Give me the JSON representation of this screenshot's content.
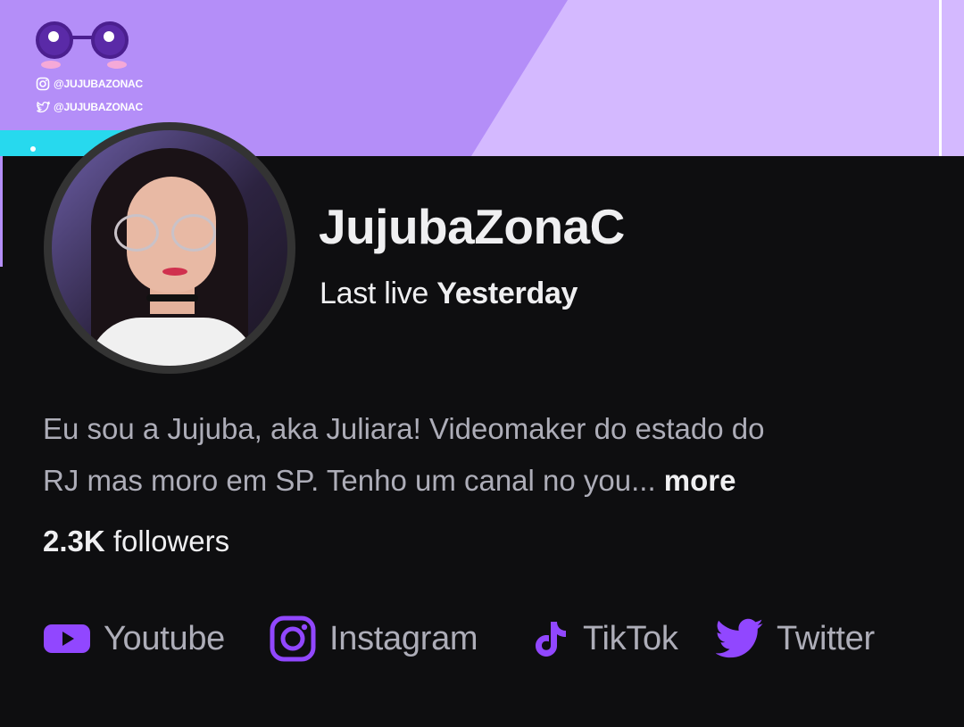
{
  "banner": {
    "instagram_handle": "@JUJUBAZONAC",
    "twitter_handle": "@JUJUBAZONAC",
    "colors": {
      "purple": "#b48ef8",
      "lavender": "#d4b9ff",
      "cyan": "#27d9ee"
    }
  },
  "profile": {
    "name": "JujubaZonaC",
    "last_live_prefix": "Last live",
    "last_live_value": "Yesterday",
    "bio_line1": "Eu sou a Jujuba, aka Juliara! Videomaker do estado do",
    "bio_line2": "RJ mas moro em SP. Tenho um canal no you...",
    "bio_more": "more",
    "followers_count": "2.3K",
    "followers_label": "followers"
  },
  "social_links": [
    {
      "label": "Youtube",
      "icon": "youtube-icon"
    },
    {
      "label": "Instagram",
      "icon": "instagram-icon"
    },
    {
      "label": "TikTok",
      "icon": "tiktok-icon"
    },
    {
      "label": "Twitter",
      "icon": "twitter-icon"
    }
  ],
  "colors": {
    "accent": "#9147ff",
    "background": "#0e0e10",
    "text_primary": "#efeff1",
    "text_secondary": "#adadb8"
  }
}
